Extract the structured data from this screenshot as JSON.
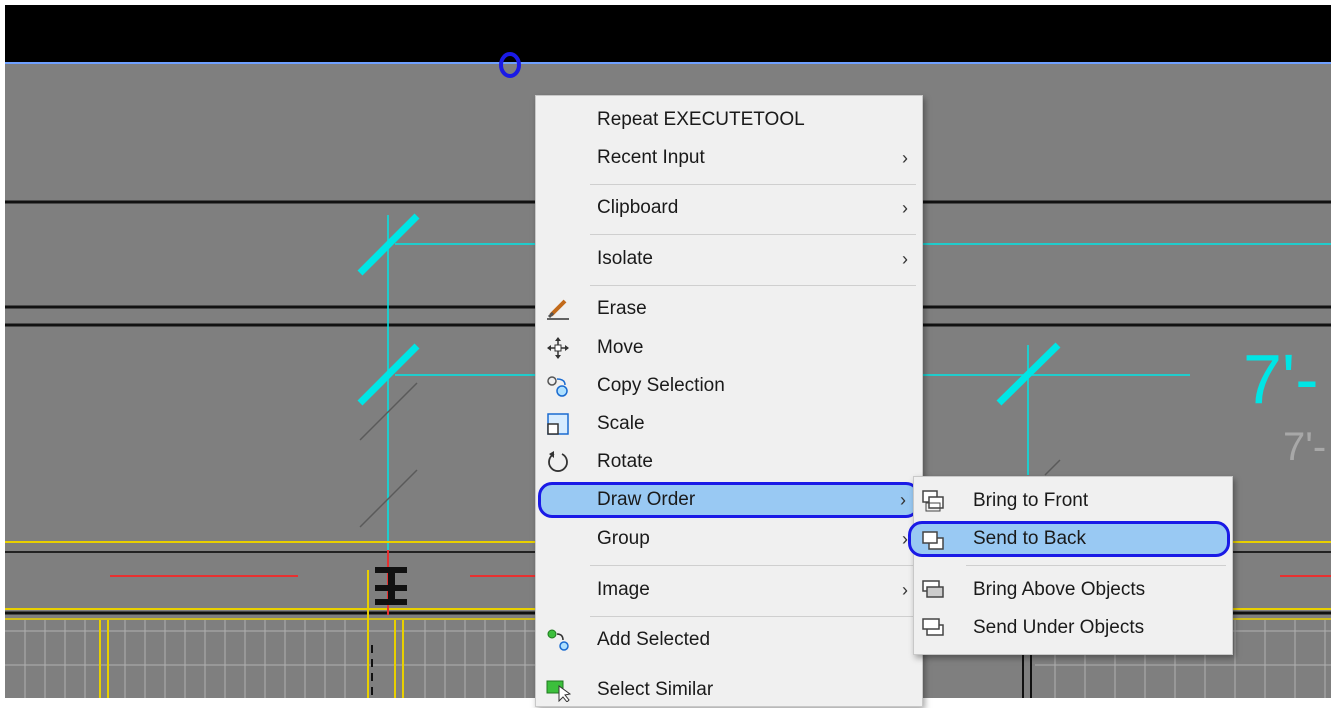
{
  "context_menu": {
    "items": [
      {
        "label": "Repeat EXECUTETOOL"
      },
      {
        "label": "Recent Input",
        "submenu": true
      },
      {
        "label": "Clipboard",
        "submenu": true
      },
      {
        "label": "Isolate",
        "submenu": true
      },
      {
        "label": "Erase",
        "icon": "erase-icon"
      },
      {
        "label": "Move",
        "icon": "move-icon"
      },
      {
        "label": "Copy Selection",
        "icon": "copy-selection-icon"
      },
      {
        "label": "Scale",
        "icon": "scale-icon"
      },
      {
        "label": "Rotate",
        "icon": "rotate-icon"
      },
      {
        "label": "Draw Order",
        "submenu": true,
        "highlighted": true
      },
      {
        "label": "Group",
        "submenu": true
      },
      {
        "label": "Image",
        "submenu": true
      },
      {
        "label": "Add Selected",
        "icon": "add-selected-icon"
      },
      {
        "label": "Select Similar",
        "icon": "select-similar-icon"
      }
    ],
    "chevron": "›"
  },
  "draw_order_submenu": {
    "items": [
      {
        "label": "Bring to Front",
        "icon": "bring-to-front-icon"
      },
      {
        "label": "Send to Back",
        "icon": "send-to-back-icon",
        "highlighted": true
      },
      {
        "label": "Bring Above Objects",
        "icon": "bring-above-objects-icon"
      },
      {
        "label": "Send Under Objects",
        "icon": "send-under-objects-icon"
      }
    ]
  },
  "drawing": {
    "dimension_large": "7'-",
    "dimension_small": "7'-"
  },
  "colors": {
    "canvas": "#7f7f7f",
    "cyan": "#00e5e5",
    "highlight_fill": "#99c9f3",
    "highlight_border": "#1a1ae6",
    "yellow": "#e8d000",
    "red": "#e83030"
  }
}
